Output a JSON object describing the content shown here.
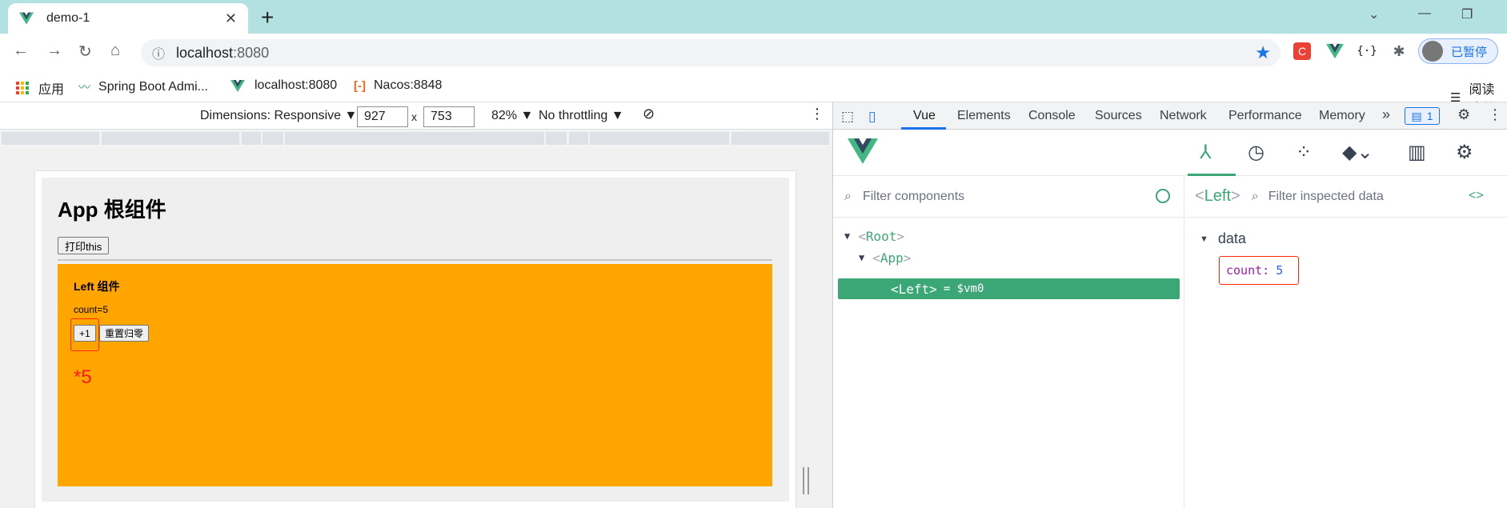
{
  "browser": {
    "tab_title": "demo-1",
    "tab_close": "✕",
    "new_tab": "+",
    "url_host": "localhost",
    "url_port": ":8080",
    "profile_label": "已暂停",
    "reading_list": "阅读清单"
  },
  "bookmarks": [
    {
      "label": "应用",
      "icon": "apps-icon"
    },
    {
      "label": "Spring Boot Admi...",
      "icon": "pulse-icon"
    },
    {
      "label": "localhost:8080",
      "icon": "vue-icon"
    },
    {
      "label": "Nacos:8848",
      "icon": "nacos-icon"
    }
  ],
  "device_toolbar": {
    "dimensions_label": "Dimensions: Responsive ▼",
    "width": "927",
    "times": "x",
    "height": "753",
    "zoom": "82% ▼",
    "throttling": "No throttling ▼"
  },
  "page": {
    "app_title": "App 根组件",
    "print_button": "打印this",
    "left_title": "Left 组件",
    "count_text": "count=5",
    "plus_button": "+1",
    "reset_button": "重置归零",
    "annotation": "*5"
  },
  "devtools": {
    "tabs": [
      "Vue",
      "Elements",
      "Console",
      "Sources",
      "Network",
      "Performance",
      "Memory"
    ],
    "more_tabs": "»",
    "badge": "1",
    "filter_placeholder": "Filter components",
    "inspect_placeholder": "Filter inspected data",
    "selected_component": "Left",
    "tree": [
      {
        "name": "Root"
      },
      {
        "name": "App"
      },
      {
        "name": "Left",
        "vm": "= $vm0"
      }
    ],
    "data_section": "data",
    "prop_key": "count:",
    "prop_value": "5"
  },
  "colors": {
    "tab_bg": "#b3e0e0",
    "vue_green": "#3ba776",
    "left_bg": "#ffa500",
    "highlight_red": "#ff2a00"
  }
}
